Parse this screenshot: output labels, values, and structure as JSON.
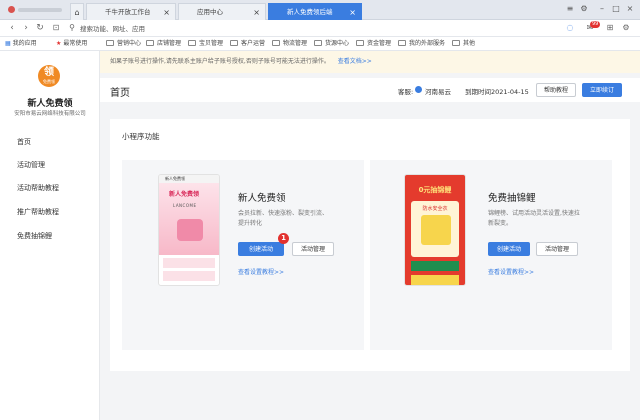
{
  "browser": {
    "tabs": [
      {
        "label": "千牛开放工作台"
      },
      {
        "label": "应用中心"
      },
      {
        "label": "新人免费领后端"
      }
    ],
    "address_placeholder": "搜索功能、网址、应用",
    "notification_count": "99"
  },
  "bookmarks": [
    "我的应用",
    "最常使用",
    "营销中心",
    "店铺管理",
    "宝贝管理",
    "客户运营",
    "物流管理",
    "货源中心",
    "资金管理",
    "我的外部服务",
    "其他"
  ],
  "app": {
    "logo_text": "领",
    "logo_sub": "免费领",
    "name": "新人免费领",
    "company": "安阳市易云网络科技有限公司"
  },
  "sidebar": {
    "items": [
      {
        "label": "首页"
      },
      {
        "label": "活动管理"
      },
      {
        "label": "活动帮助教程"
      },
      {
        "label": "推广帮助教程"
      },
      {
        "label": "免费抽锦鲤"
      }
    ]
  },
  "notice": {
    "text": "如果子账号进行操作,请先联系主账户给子账号授权,否则子账号可能无法进行操作。",
    "link": "查看文档>>"
  },
  "header": {
    "title": "首页",
    "service_label": "客服:",
    "service_name": "河南易云",
    "expire": "到期时间2021-04-15",
    "help_button": "帮助教程",
    "order_button": "立即续订"
  },
  "panel": {
    "title": "小程序功能",
    "cards": [
      {
        "title": "新人免费领",
        "desc": "会员拉新、快速涨粉、裂变引流、提升转化",
        "create_button": "创建活动",
        "manage_button": "活动管理",
        "link": "查看设置教程>>",
        "step_badge": "1",
        "phone": {
          "header": "新人免费领",
          "banner": "新人免费领",
          "brand": "LANCOME"
        }
      },
      {
        "title": "免费抽锦鲤",
        "desc": "锦鲤榜、试用活动灵活设置,快速拉新裂变。",
        "create_button": "创建活动",
        "manage_button": "活动管理",
        "link": "查看设置教程>>",
        "phone": {
          "banner": "0元抽锦鲤",
          "label": "防水安全衣"
        }
      }
    ]
  },
  "colors": {
    "accent": "#3a7de0",
    "badge": "#e2312f",
    "logo": "#f08a24"
  }
}
